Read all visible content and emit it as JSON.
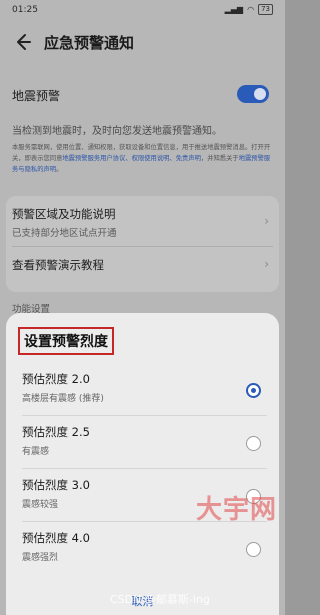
{
  "status_bar": {
    "time": "01:25",
    "battery": "73",
    "icons": [
      "wifi-icon",
      "signal-icon"
    ]
  },
  "header": {
    "title": "应急预警通知"
  },
  "earthquake": {
    "label": "地震预警",
    "enabled": true,
    "description": "当检测到地震时，及时向您发送地震预警通知。",
    "fine_print_1": "本服务需联网，使用位置、通知权限，获取设备和位置信息，用于推送地震预警消息。打开开关，即表示您同意",
    "fine_print_link_1": "地震预警服务用户协议、权限使用说明、免责声明",
    "fine_print_2": "，并知悉关于",
    "fine_print_link_2": "地震预警服务与隐私的声明",
    "fine_print_3": "。"
  },
  "menu": [
    {
      "title": "预警区域及功能说明",
      "subtitle": "已支持部分地区试点开通"
    },
    {
      "title": "查看预警演示教程",
      "subtitle": ""
    }
  ],
  "section_label": "功能设置",
  "sheet": {
    "title": "设置预警烈度",
    "options": [
      {
        "title": "预估烈度 2.0",
        "subtitle": "高楼层有震感 (推荐)",
        "selected": true
      },
      {
        "title": "预估烈度 2.5",
        "subtitle": "有震感",
        "selected": false
      },
      {
        "title": "预估烈度 3.0",
        "subtitle": "震感较强",
        "selected": false
      },
      {
        "title": "预估烈度 4.0",
        "subtitle": "震感强烈",
        "selected": false
      }
    ],
    "cancel": "取消"
  },
  "watermarks": {
    "site": "大宇网",
    "csdn": "CSDN @郁慕斯-ing"
  },
  "colors": {
    "accent": "#2a5bb8",
    "highlight_box": "#c62828"
  }
}
